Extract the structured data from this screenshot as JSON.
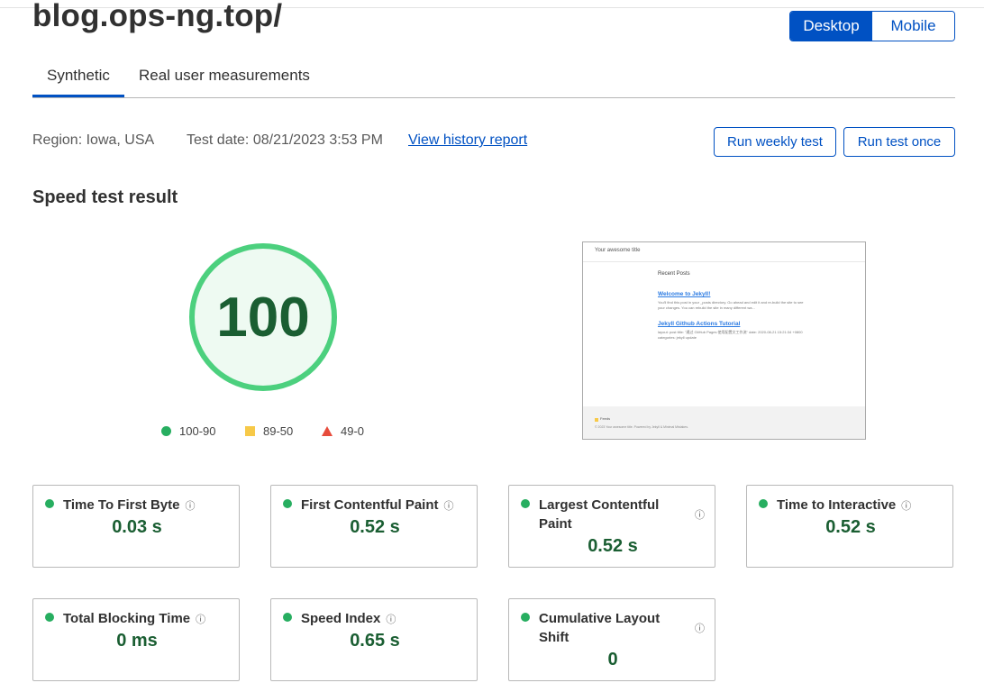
{
  "site": {
    "title": "blog.ops-ng.top/"
  },
  "device_toggle": {
    "desktop": "Desktop",
    "mobile": "Mobile",
    "selected": "Desktop"
  },
  "tabs": [
    {
      "label": "Synthetic",
      "active": true
    },
    {
      "label": "Real user measurements",
      "active": false
    }
  ],
  "test_info": {
    "region": "Region: Iowa, USA",
    "date": "Test date: 08/21/2023 3:53 PM",
    "history_link": "View history report",
    "weekly_button": "Run weekly test",
    "once_button": "Run test once"
  },
  "result": {
    "title": "Speed test result",
    "score": "100",
    "score_value": 100,
    "legend": [
      {
        "label": "100-90",
        "shape": "circle",
        "color": "#27ae60"
      },
      {
        "label": "89-50",
        "shape": "square",
        "color": "#f7c948"
      },
      {
        "label": "49-0",
        "shape": "triangle",
        "color": "#e74c3c"
      }
    ]
  },
  "preview": {
    "header": "Your awesome title",
    "section": "Recent Posts",
    "posts": [
      {
        "title": "Welcome to Jekyll!",
        "excerpt": "You'll find this post in your _posts directory. Go ahead and edit it and re-build the site to see your changes. You can rebuild the site in many different wa..."
      },
      {
        "title": "Jekyll Github Actions Tutorial",
        "excerpt": "layout: post title: \"通过 GitHub Pages 使用配置文工作流\" date: 2020-08-21 15:21:34 +0800 categories: jekyll update"
      }
    ],
    "footer_title": "Feeds",
    "footer_text": "© 2023 Your awesome title. Powered by Jekyll & Minimal Mistakes."
  },
  "metrics": [
    {
      "label": "Time To First Byte",
      "value": "0.03 s",
      "info": "ⓘ"
    },
    {
      "label": "First Contentful Paint",
      "value": "0.52 s",
      "info": "ⓘ"
    },
    {
      "label": "Largest Contentful Paint",
      "value": "0.52 s",
      "info": "ⓘ"
    },
    {
      "label": "Time to Interactive",
      "value": "0.52 s",
      "info": "ⓘ"
    },
    {
      "label": "Total Blocking Time",
      "value": "0 ms",
      "info": "ⓘ"
    },
    {
      "label": "Speed Index",
      "value": "0.65 s",
      "info": "ⓘ"
    },
    {
      "label": "Cumulative Layout Shift",
      "value": "0",
      "info": "ⓘ"
    }
  ],
  "colors": {
    "accent": "#0051c3",
    "good": "#27ae60",
    "score_text": "#1a5e32",
    "score_ring": "#4cd07e",
    "score_fill": "#eefaf2"
  }
}
